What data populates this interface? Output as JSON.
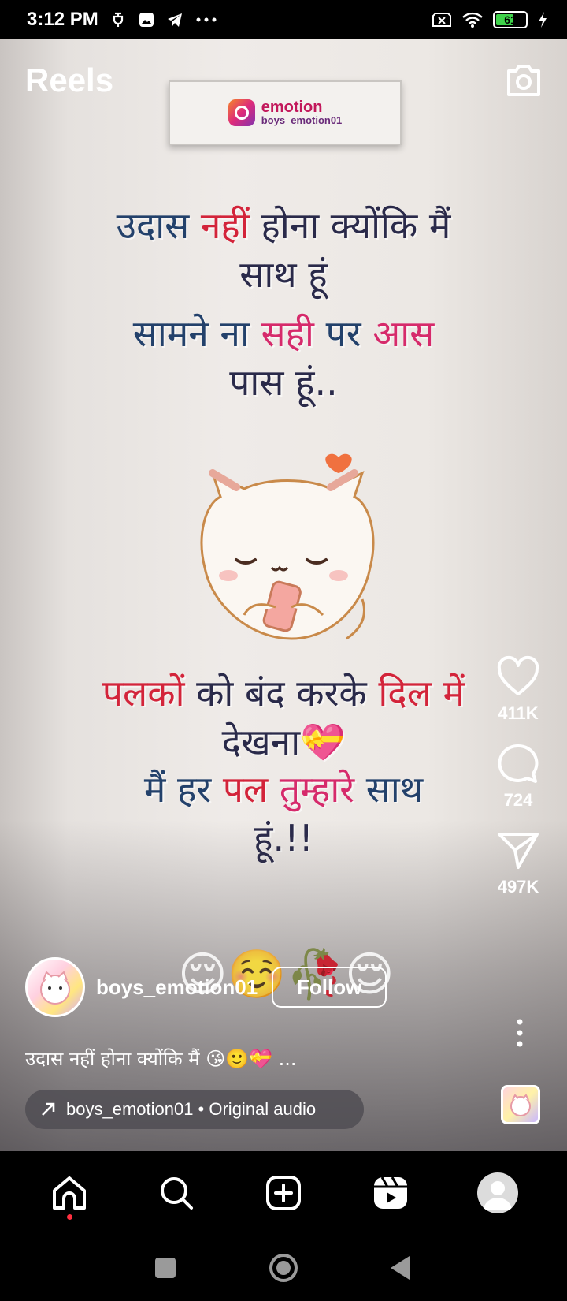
{
  "status_bar": {
    "time": "3:12 PM",
    "battery_level": "61",
    "battery_fraction": 0.61,
    "icons": [
      "usb-debug-icon",
      "gallery-icon",
      "telegram-icon",
      "more-dots-icon",
      "no-sim-icon",
      "wifi-icon",
      "battery-icon",
      "charging-icon"
    ]
  },
  "header": {
    "title": "Reels"
  },
  "video": {
    "logo_line1": "emotion",
    "logo_line2": "boys_emotion01",
    "text_block_1": {
      "line1_a": "उदास",
      "line1_b": "नहीं",
      "line1_c": "होना क्योंकि मैं",
      "line2": "साथ हूं"
    },
    "text_block_2": {
      "line1_a": "सामने ना",
      "line1_b": "सही",
      "line1_c": "पर",
      "line1_d": "आस",
      "line2": "पास हूं.."
    },
    "text_block_3": {
      "line1_a": "पलकों",
      "line1_b": "को बंद करके",
      "line1_c": "दिल में",
      "line2": "देखना💝"
    },
    "text_block_4": {
      "line1_a": "मैं हर",
      "line1_b": "पल",
      "line1_c": "तुम्हारे",
      "line1_d": "साथ",
      "line2": "हूं.!!"
    },
    "emojis": "😌☺️🥀😌"
  },
  "actions": {
    "likes": "411K",
    "comments": "724",
    "shares": "497K"
  },
  "post": {
    "username": "boys_emotion01",
    "follow_label": "Follow",
    "caption": "उदास नहीं होना क्योंकि मैं 😘🙂💝 ...",
    "audio": "boys_emotion01 • Original audio"
  },
  "colors": {
    "accent_red": "#d3243a",
    "battery_green": "#3fd34b",
    "notification_dot": "#ff3040"
  }
}
